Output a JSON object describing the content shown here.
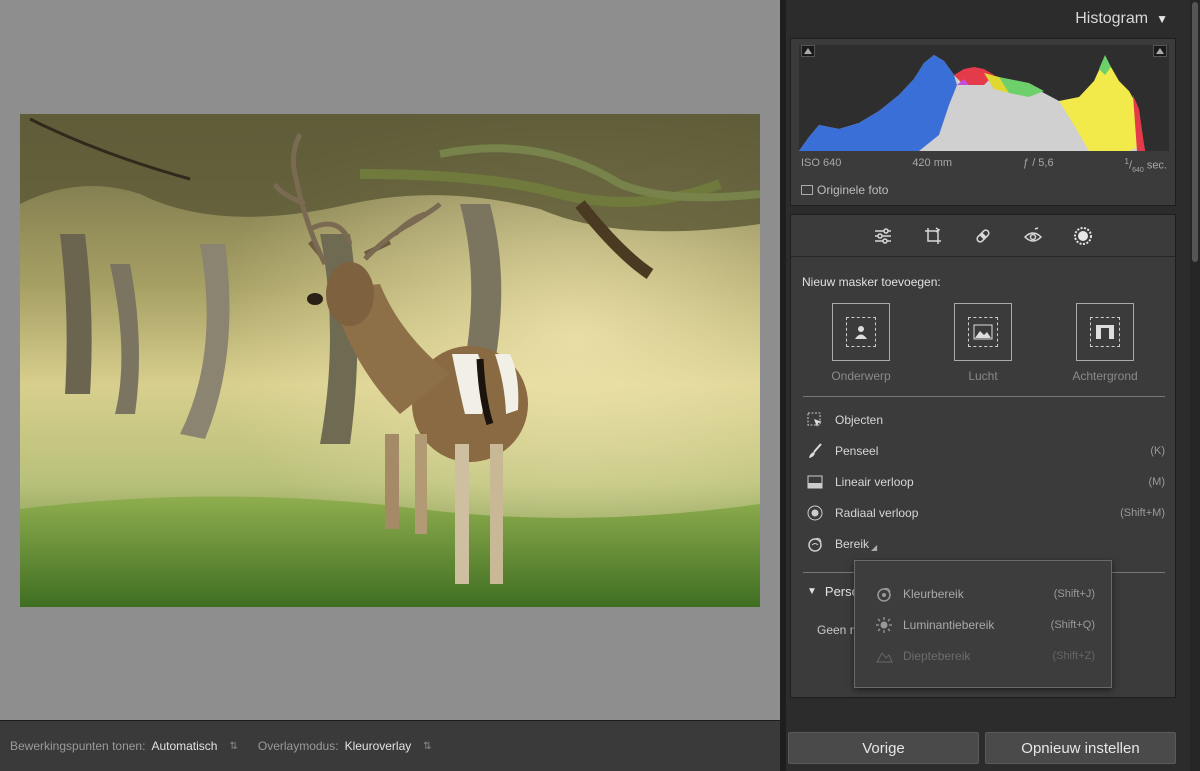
{
  "viewer": {
    "toolbar": {
      "edit_points_label": "Bewerkingspunten tonen:",
      "edit_points_value": "Automatisch",
      "overlay_label": "Overlaymodus:",
      "overlay_value": "Kleuroverlay"
    }
  },
  "histogram": {
    "title": "Histogram",
    "iso": "ISO 640",
    "focal_length": "420 mm",
    "aperture": "ƒ / 5,6",
    "shutter_num": "1",
    "shutter_den": "640",
    "shutter_unit": "sec.",
    "original_photo_label": "Originele foto"
  },
  "masking": {
    "new_mask_label": "Nieuw masker toevoegen:",
    "types": [
      {
        "label": "Onderwerp"
      },
      {
        "label": "Lucht"
      },
      {
        "label": "Achtergrond"
      }
    ],
    "items": [
      {
        "label": "Objecten",
        "shortcut": ""
      },
      {
        "label": "Penseel",
        "shortcut": "(K)"
      },
      {
        "label": "Lineair verloop",
        "shortcut": "(M)"
      },
      {
        "label": "Radiaal verloop",
        "shortcut": "(Shift+M)"
      },
      {
        "label": "Bereik",
        "shortcut": ""
      }
    ],
    "section_label": "Perso",
    "empty_label": "Geen m"
  },
  "range_menu": {
    "items": [
      {
        "label": "Kleurbereik",
        "shortcut": "(Shift+J)",
        "enabled": true
      },
      {
        "label": "Luminantiebereik",
        "shortcut": "(Shift+Q)",
        "enabled": true
      },
      {
        "label": "Dieptebereik",
        "shortcut": "(Shift+Z)",
        "enabled": false
      }
    ]
  },
  "footer": {
    "previous_label": "Vorige",
    "reset_label": "Opnieuw instellen"
  },
  "colors": {
    "panel_bg": "#3b3b3b",
    "viewer_bg": "#8e8e8e",
    "button_bg": "#4a4a4a"
  }
}
